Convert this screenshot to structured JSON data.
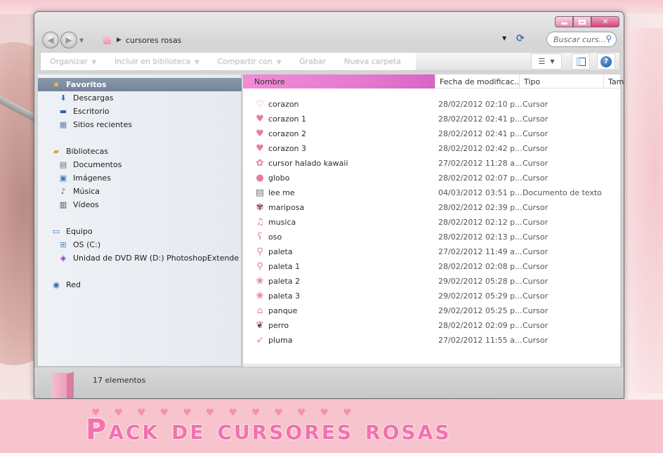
{
  "window": {
    "minimize_icon": "minimize-icon",
    "maximize_icon": "maximize-icon",
    "close_label": "✕"
  },
  "address": {
    "breadcrumb": "cursores rosas",
    "search_placeholder": "Buscar curs..."
  },
  "toolbar": {
    "items": [
      "Organizar",
      "Incluir en biblioteca",
      "Compartir con",
      "Grabar",
      "Nueva carpeta"
    ]
  },
  "nav": {
    "favorites": "Favoritos",
    "favorites_items": [
      "Descargas",
      "Escritorio",
      "Sitios recientes"
    ],
    "libraries": "Bibliotecas",
    "libraries_items": [
      "Documentos",
      "Imágenes",
      "Música",
      "Vídeos"
    ],
    "computer": "Equipo",
    "computer_items": [
      "OS (C:)",
      "Unidad de DVD RW (D:) PhotoshopExtende"
    ],
    "network": "Red"
  },
  "columns": {
    "name": "Nombre",
    "date": "Fecha de modificac...",
    "type": "Tipo",
    "size": "Tam"
  },
  "files": [
    {
      "name": "corazon",
      "date": "28/02/2012 02:10 p...",
      "type": "Cursor",
      "icon": "heart-outline-icon"
    },
    {
      "name": "corazon 1",
      "date": "28/02/2012 02:41 p...",
      "type": "Cursor",
      "icon": "heart-icon"
    },
    {
      "name": "corazon 2",
      "date": "28/02/2012 02:41 p...",
      "type": "Cursor",
      "icon": "heart-icon"
    },
    {
      "name": "corazon 3",
      "date": "28/02/2012 02:42 p...",
      "type": "Cursor",
      "icon": "heart-icon"
    },
    {
      "name": "cursor halado kawaii",
      "date": "27/02/2012 11:28 a...",
      "type": "Cursor",
      "icon": "ice-cream-icon"
    },
    {
      "name": "globo",
      "date": "28/02/2012 02:07 p...",
      "type": "Cursor",
      "icon": "balloon-icon"
    },
    {
      "name": "lee me",
      "date": "04/03/2012 03:51 p...",
      "type": "Documento de texto",
      "icon": "text-document-icon"
    },
    {
      "name": "mariposa",
      "date": "28/02/2012 02:39 p...",
      "type": "Cursor",
      "icon": "butterfly-icon"
    },
    {
      "name": "musica",
      "date": "28/02/2012 02:12 p...",
      "type": "Cursor",
      "icon": "music-note-icon"
    },
    {
      "name": "oso",
      "date": "28/02/2012 02:13 p...",
      "type": "Cursor",
      "icon": "bear-icon"
    },
    {
      "name": "paleta",
      "date": "27/02/2012 11:49 a...",
      "type": "Cursor",
      "icon": "lollipop-icon"
    },
    {
      "name": "paleta 1",
      "date": "28/02/2012 02:08 p...",
      "type": "Cursor",
      "icon": "lollipop-icon"
    },
    {
      "name": "paleta 2",
      "date": "29/02/2012 05:28 p...",
      "type": "Cursor",
      "icon": "candy-icon"
    },
    {
      "name": "paleta 3",
      "date": "29/02/2012 05:29 p...",
      "type": "Cursor",
      "icon": "candy-icon"
    },
    {
      "name": "panque",
      "date": "29/02/2012 05:25 p...",
      "type": "Cursor",
      "icon": "cupcake-icon"
    },
    {
      "name": "perro",
      "date": "28/02/2012 02:09 p...",
      "type": "Cursor",
      "icon": "dog-icon"
    },
    {
      "name": "pluma",
      "date": "27/02/2012 11:55 a...",
      "type": "Cursor",
      "icon": "feather-icon"
    }
  ],
  "status": {
    "count": "17 elementos"
  },
  "banner": {
    "title": "Pack de cursores rosas"
  },
  "colors": {
    "accent_pink": "#f271ae",
    "header_pink": "#e57ad0",
    "banner_bg": "#f7c4cd"
  }
}
